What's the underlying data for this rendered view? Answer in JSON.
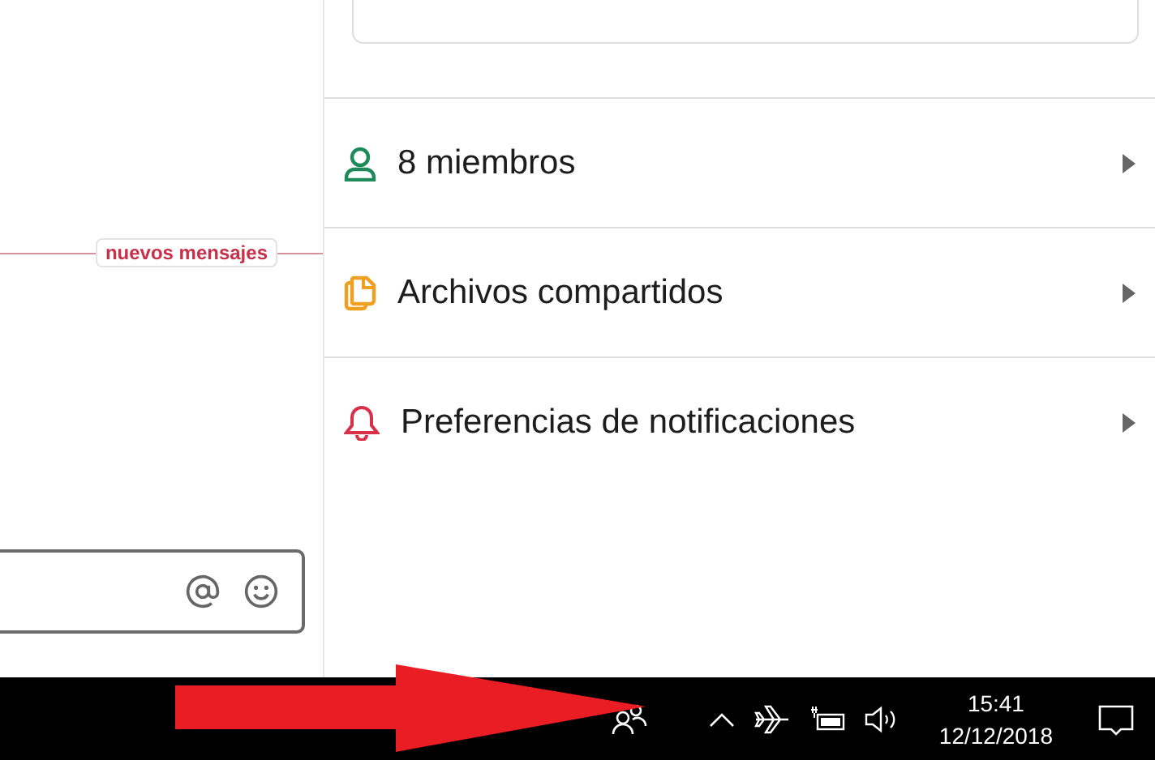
{
  "conversation": {
    "new_messages_label": "nuevos mensajes"
  },
  "details_menu": [
    {
      "kind": "members",
      "label": "8 miembros",
      "color": "#1e8a5c"
    },
    {
      "kind": "files",
      "label": "Archivos compartidos",
      "color": "#f0a020"
    },
    {
      "kind": "notifications",
      "label": "Preferencias de notificaciones",
      "color": "#d9304a"
    }
  ],
  "taskbar": {
    "time": "15:41",
    "date": "12/12/2018"
  }
}
